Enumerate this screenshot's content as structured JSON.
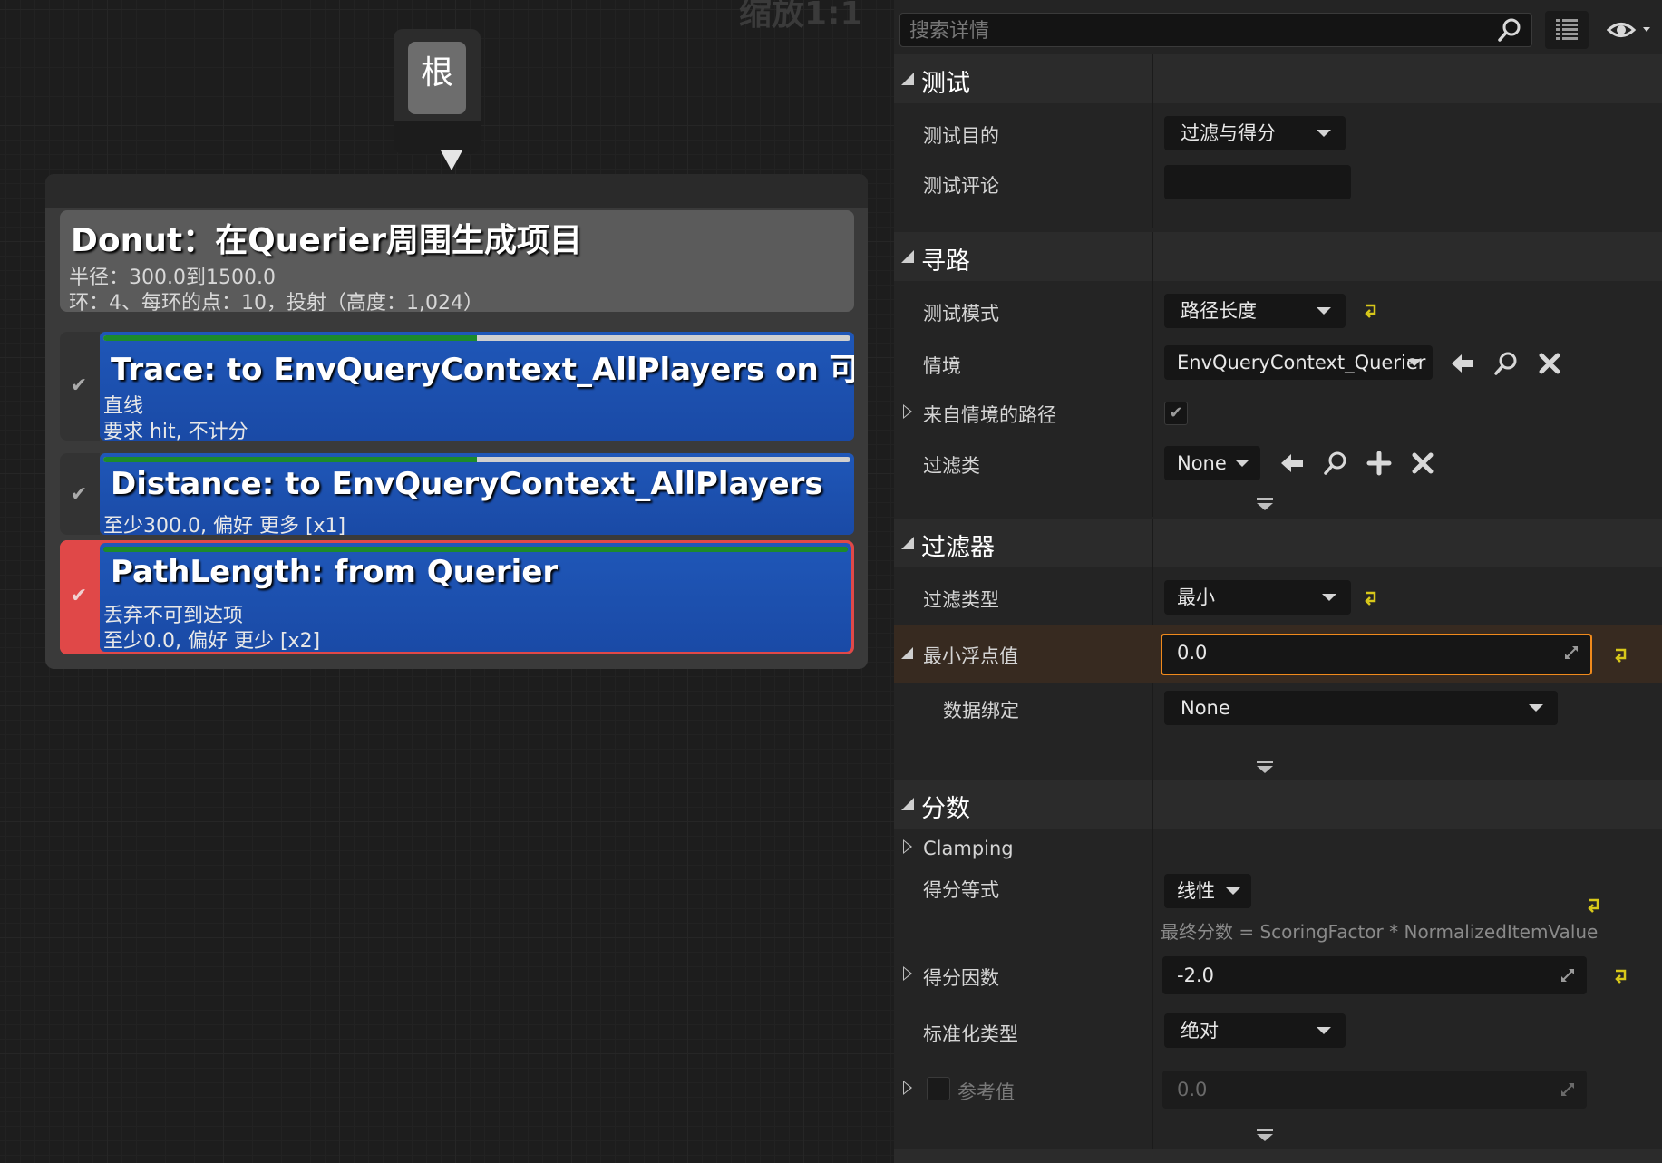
{
  "graph": {
    "zoom_label": "缩放1:1",
    "root": {
      "label": "根"
    },
    "generator": {
      "title": "Donut：在Querier周围生成项目",
      "line1": "半径：300.0到1500.0",
      "line2": "环：4、每环的点：10，投射（高度：1,024）"
    },
    "tests": [
      {
        "title": "Trace: to EnvQueryContext_AllPlayers on 可视性",
        "line1": "直线",
        "line2": "要求 hit, 不计分",
        "bar_fill": 0.5,
        "selected": false
      },
      {
        "title": "Distance: to EnvQueryContext_AllPlayers",
        "line1": "至少300.0, 偏好 更多 [x1]",
        "bar_fill": 0.5,
        "selected": false
      },
      {
        "title": "PathLength: from Querier",
        "line1": "丢弃不可到达项",
        "line2": "至少0.0, 偏好 更少 [x2]",
        "bar_fill": 1.0,
        "selected": true
      }
    ]
  },
  "details": {
    "search": {
      "placeholder": "搜索详情"
    },
    "sections": {
      "test": "测试",
      "pathfinding": "寻路",
      "filter": "过滤器",
      "score": "分数"
    },
    "test": {
      "purpose_label": "测试目的",
      "purpose_value": "过滤与得分",
      "comment_label": "测试评论",
      "comment_value": ""
    },
    "pathfinding": {
      "mode_label": "测试模式",
      "mode_value": "路径长度",
      "context_label": "情境",
      "context_value": "EnvQueryContext_Querier",
      "path_from_context_label": "来自情境的路径",
      "filter_class_label": "过滤类",
      "filter_class_value": "None"
    },
    "filter": {
      "type_label": "过滤类型",
      "type_value": "最小",
      "min_float_label": "最小浮点值",
      "min_float_value": "0.0",
      "data_binding_label": "数据绑定",
      "data_binding_value": "None"
    },
    "score": {
      "clamping_label": "Clamping",
      "equation_label": "得分等式",
      "equation_value": "线性",
      "equation_formula": "最终分数 = ScoringFactor * NormalizedItemValue",
      "factor_label": "得分因数",
      "factor_value": "-2.0",
      "normalization_label": "标准化类型",
      "normalization_value": "绝对",
      "reference_label": "参考值",
      "reference_value": "0.0"
    }
  },
  "colors": {
    "accent_orange": "#f08a1c",
    "test_blue": "#1f57b8",
    "selected_red": "#e04848",
    "progress_green": "#1c8a2c",
    "reset_yellow": "#d8c81a"
  }
}
